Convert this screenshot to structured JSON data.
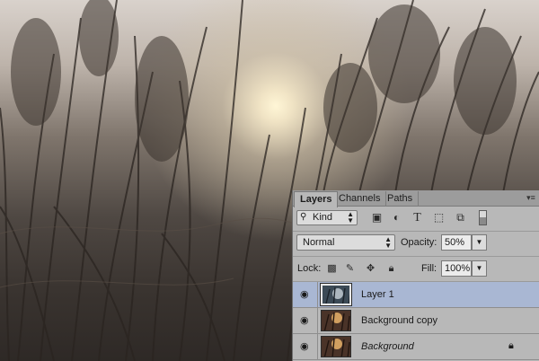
{
  "panel": {
    "tabs": [
      {
        "label": "Layers",
        "active": true
      },
      {
        "label": "Channels",
        "active": false
      },
      {
        "label": "Paths",
        "active": false
      }
    ],
    "menu_icon": "panel-menu-icon",
    "filter": {
      "kind_label": "Kind",
      "icons": [
        "image-filter-icon",
        "adjustment-filter-icon",
        "type-filter-icon",
        "shape-filter-icon",
        "smart-object-filter-icon"
      ]
    },
    "blend_mode": "Normal",
    "opacity_label": "Opacity:",
    "opacity_value": "50%",
    "lock_label": "Lock:",
    "fill_label": "Fill:",
    "fill_value": "100%",
    "layers": [
      {
        "name": "Layer 1",
        "selected": true,
        "italic": false,
        "locked": false
      },
      {
        "name": "Background copy",
        "selected": false,
        "italic": false,
        "locked": false
      },
      {
        "name": "Background",
        "selected": false,
        "italic": true,
        "locked": true
      }
    ]
  },
  "colors": {
    "panel_bg": "#b8b8b8",
    "selected_layer": "#a9b7d3",
    "tab_bar": "#9c9c9c"
  }
}
